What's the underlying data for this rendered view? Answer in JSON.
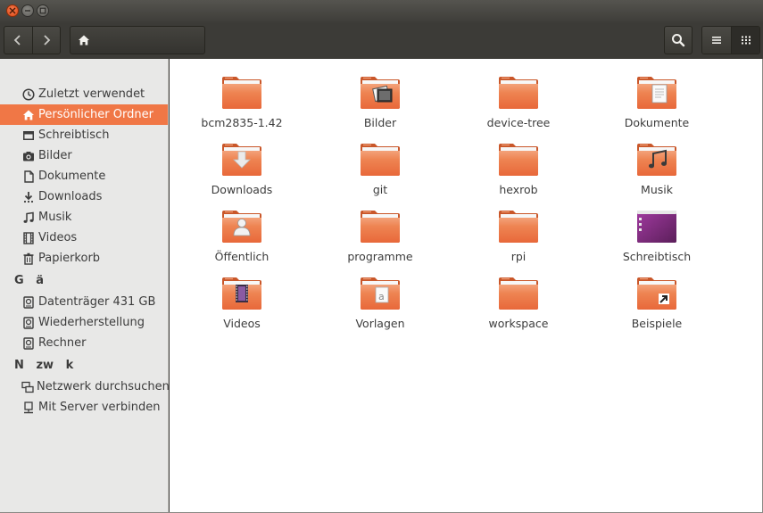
{
  "window": {
    "title": ""
  },
  "toolbar": {
    "back": "back",
    "forward": "forward",
    "home_crumb": "home"
  },
  "sidebar": {
    "items_top": [
      {
        "label": "Zuletzt verwendet",
        "icon": "clock-icon"
      },
      {
        "label": "Persönlicher Ordner",
        "icon": "home-icon",
        "selected": true
      },
      {
        "label": "Schreibtisch",
        "icon": "desktop-icon"
      },
      {
        "label": "Bilder",
        "icon": "camera-icon"
      },
      {
        "label": "Dokumente",
        "icon": "document-icon"
      },
      {
        "label": "Downloads",
        "icon": "download-icon"
      },
      {
        "label": "Musik",
        "icon": "music-icon"
      },
      {
        "label": "Videos",
        "icon": "film-icon"
      },
      {
        "label": "Papierkorb",
        "icon": "trash-icon"
      }
    ],
    "header_devices": "G   ä",
    "devices": [
      {
        "label": "Datenträger 431 GB",
        "icon": "drive-icon"
      },
      {
        "label": "Wiederherstellung",
        "icon": "drive-icon"
      },
      {
        "label": "Rechner",
        "icon": "drive-icon"
      }
    ],
    "header_network": "N   zw   k",
    "network": [
      {
        "label": "Netzwerk durchsuchen",
        "icon": "network-icon"
      },
      {
        "label": "Mit Server verbinden",
        "icon": "server-icon"
      }
    ]
  },
  "files": [
    {
      "label": "bcm2835-1.42",
      "emblem": "none"
    },
    {
      "label": "Bilder",
      "emblem": "pictures"
    },
    {
      "label": "device-tree",
      "emblem": "none"
    },
    {
      "label": "Dokumente",
      "emblem": "documents"
    },
    {
      "label": "Downloads",
      "emblem": "download"
    },
    {
      "label": "git",
      "emblem": "none"
    },
    {
      "label": "hexrob",
      "emblem": "none"
    },
    {
      "label": "Musik",
      "emblem": "music"
    },
    {
      "label": "Öffentlich",
      "emblem": "public"
    },
    {
      "label": "programme",
      "emblem": "none"
    },
    {
      "label": "rpi",
      "emblem": "none"
    },
    {
      "label": "Schreibtisch",
      "emblem": "desktop"
    },
    {
      "label": "Videos",
      "emblem": "videos"
    },
    {
      "label": "Vorlagen",
      "emblem": "templates"
    },
    {
      "label": "workspace",
      "emblem": "none"
    },
    {
      "label": "Beispiele",
      "emblem": "link"
    }
  ],
  "colors": {
    "accent": "#f07746",
    "folder_top": "#f3a27a",
    "folder_body": "#e8683a"
  }
}
